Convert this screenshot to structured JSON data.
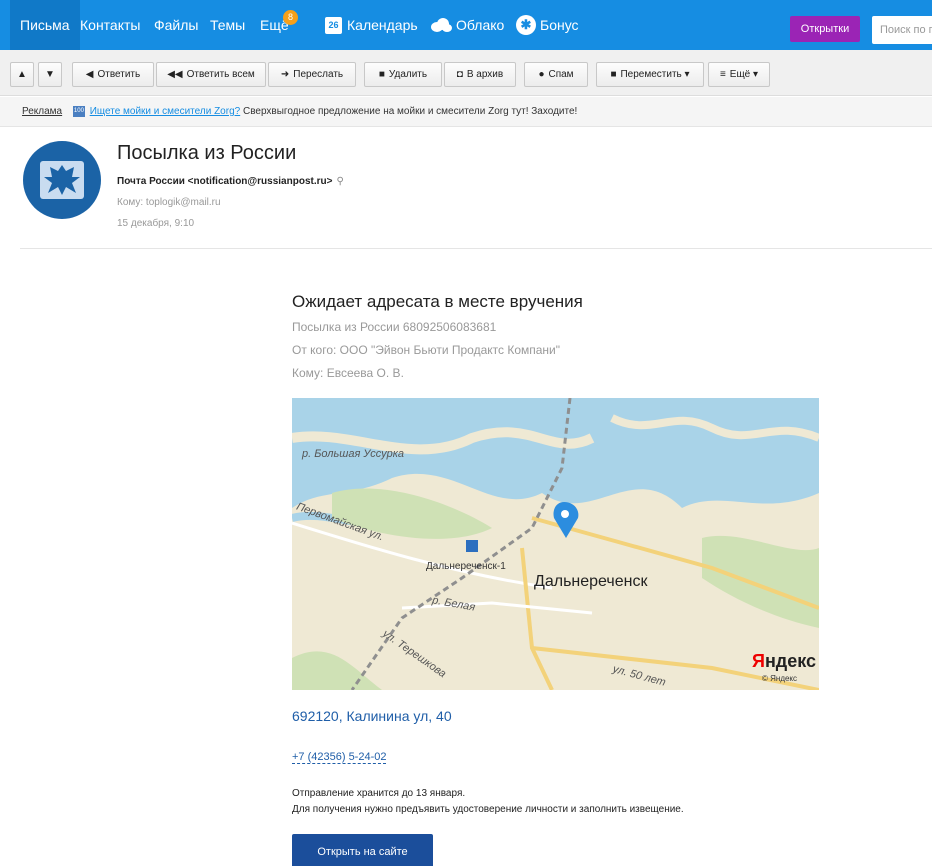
{
  "nav": {
    "items": [
      "Письма",
      "Контакты",
      "Файлы",
      "Темы",
      "Ещё"
    ],
    "more_badge": "8",
    "calendar_day": "26",
    "calendar": "Календарь",
    "cloud": "Облако",
    "bonus": "Бонус",
    "postcards": "Открытки",
    "search_placeholder": "Поиск по почте",
    "accent": "#168de2"
  },
  "toolbar": {
    "reply": "Ответить",
    "reply_all": "Ответить всем",
    "forward": "Переслать",
    "delete": "Удалить",
    "archive": "В архив",
    "spam": "Спам",
    "move": "Переместить",
    "more": "Ещё"
  },
  "ad": {
    "label": "Реклама",
    "logo": "100",
    "link": "Ищете мойки и смесители Zorg?",
    "text": "Сверхвыгодное предложение на мойки и смесители Zorg тут! Заходите!"
  },
  "email": {
    "subject": "Посылка из России",
    "from": "Почта России <notification@russianpost.ru>",
    "to": "Кому: toplogik@mail.ru",
    "date": "15 декабря, 9:10"
  },
  "body": {
    "title": "Ожидает адресата в месте вручения",
    "parcel": "Посылка из России 68092506083681",
    "sender": "От кого: ООО \"Эйвон Бьюти Продактс Компани\"",
    "recipient": "Кому: Евсеева О. В.",
    "address": "692120, Калинина ул, 40",
    "phone": "+7 (42356) 5-24-02",
    "note1": "Отправление хранится до 13 января.",
    "note2": "Для получения нужно предъявить удостоверение личности и заполнить извещение.",
    "open_button": "Открыть на сайте"
  },
  "map": {
    "river": "р. Большая Уссурка",
    "street1": "Первомайская ул.",
    "station": "Дальнереченск-1",
    "city": "Дальнереченск",
    "street2": "р. Белая",
    "street3": "ул. Терешкова",
    "street4": "ул. 50 лет",
    "yandex_y": "Я",
    "yandex_rest": "ндекс",
    "yandex_copy": "© Яндекс"
  }
}
